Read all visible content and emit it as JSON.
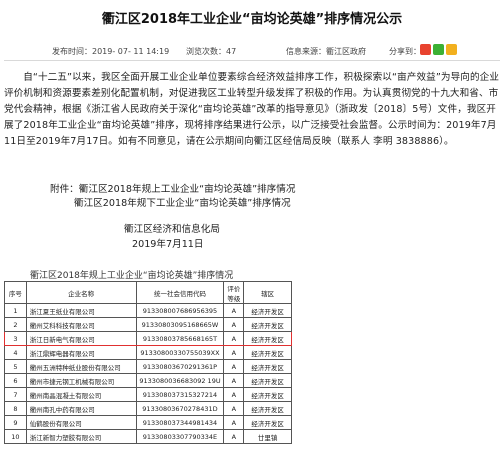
{
  "article": {
    "title": "衢江区2018年工业企业“亩均论英雄”排序情况公示",
    "publish_time": "发布时间：2019- 07- 11 14:19",
    "views": "浏览次数：47",
    "source": "信息来源：衢江区政府",
    "share_label": "分享到：",
    "share_icons": [
      "weibo-icon",
      "wechat-icon",
      "qzone-icon"
    ],
    "paragraph": "自“十二五”以来，我区全面开展工业企业单位要素综合经济效益排序工作，积极探索以“亩产效益”为导向的企业评价机制和资源要素差别化配置机制，对促进我区工业转型升级发挥了积极的作用。为认真贯彻党的十九大和省、市党代会精神，根据《浙江省人民政府关于深化“亩均论英雄”改革的指导意见》（浙政发〔2018〕5号）文件，我区开展了2018年工业企业“亩均论英雄”排序，现将排序结果进行公示，以广泛接受社会监督。公示时间为：2019年7月11日至2019年7月17日。如有不同意见，请在公示期间向衢江区经信局反映（联系人 李明 3838886）。"
  },
  "attachments": {
    "line1": "附件：衢江区2018年规上工业企业“亩均论英雄”排序情况",
    "line2": "衢江区2018年规下工业企业“亩均论英雄”排序情况"
  },
  "signature": {
    "org": "衢江区经济和信息化局",
    "date": "2019年7月11日"
  },
  "table": {
    "caption": "衢江区2018年规上工业企业“亩均论英雄”排序情况",
    "headers": [
      "序号",
      "企业名称",
      "统一社会信用代码",
      "评价等级",
      "辖区"
    ],
    "rows": [
      [
        "1",
        "浙江夏王纸业有限公司",
        "913308007686956395",
        "A",
        "经济开发区"
      ],
      [
        "2",
        "衢州艾科科技有限公司",
        "91330803095168665W",
        "A",
        "经济开发区"
      ],
      [
        "3",
        "浙江日新电气有限公司",
        "91330803785668165T",
        "A",
        "经济开发区"
      ],
      [
        "4",
        "浙江鼎辉电器有限公司",
        "91330800330755039XX",
        "A",
        "经济开发区"
      ],
      [
        "5",
        "衢州五洲特种纸业股份有限公司",
        "913308036702913​61P",
        "A",
        "经济开发区"
      ],
      [
        "6",
        "衢州市捷元钢工机械有限公司",
        "9133080036683092 19U",
        "A",
        "经济开发区"
      ],
      [
        "7",
        "衢州南晶混凝土有限公司",
        "913308037315327214",
        "A",
        "经济开发区"
      ],
      [
        "8",
        "衢州南孔中药有限公司",
        "91330803670278431D",
        "A",
        "经济开发区"
      ],
      [
        "9",
        "仙鹤股份有限公司",
        "913308037344981434",
        "A",
        "经济开发区"
      ],
      [
        "10",
        "浙江新智力塑胶有限公司",
        "91330803307790334E",
        "A",
        "廿里镇"
      ]
    ],
    "highlighted_row": 3,
    "highlight_color": "#e03030"
  }
}
